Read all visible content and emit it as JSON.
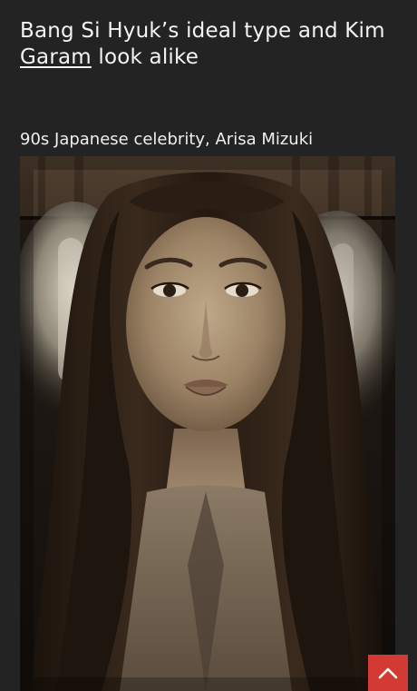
{
  "article": {
    "title_part1": "Bang Si Hyuk’s ideal type and Kim ",
    "title_link": "Garam",
    "title_part2": " look alike",
    "caption": "90s Japanese celebrity, Arisa Mizuki"
  },
  "photo": {
    "subject": "sepia portrait of a young woman with long dark hair"
  },
  "scroll_top": {
    "icon": "chevron-up-icon",
    "color": "#d43a34"
  },
  "theme": {
    "background": "#232323",
    "text": "#f4f4f4"
  }
}
